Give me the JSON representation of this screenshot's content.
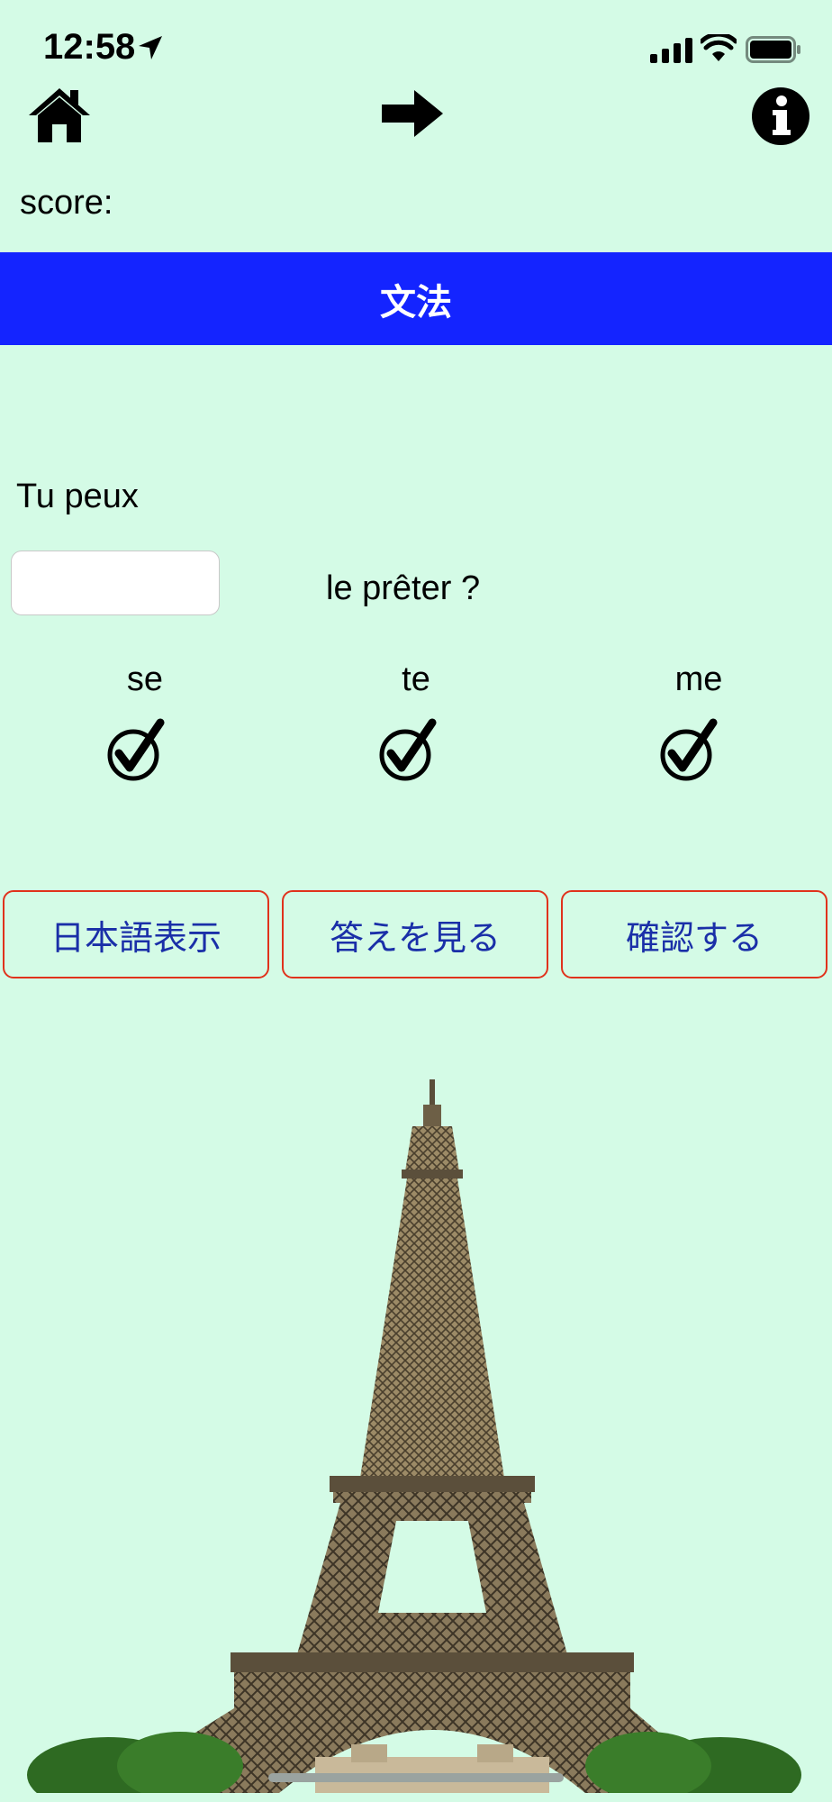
{
  "status_bar": {
    "time": "12:58",
    "icons": [
      "location-arrow-icon",
      "signal-icon",
      "wifi-icon",
      "battery-icon"
    ]
  },
  "nav": {
    "icons": [
      "home-icon",
      "arrow-right-icon",
      "info-icon"
    ]
  },
  "score_label": "score:",
  "banner_title": "文法",
  "question": {
    "line1": "Tu peux",
    "input_value": "",
    "line2": "le prêter ?"
  },
  "choices": [
    {
      "label": "se",
      "icon": "check-circle-icon"
    },
    {
      "label": "te",
      "icon": "check-circle-icon"
    },
    {
      "label": "me",
      "icon": "check-circle-icon"
    }
  ],
  "actions": {
    "show_japanese": "日本語表示",
    "show_answer": "答えを見る",
    "confirm": "確認する"
  },
  "image": {
    "subject": "eiffel-tower-illustration"
  },
  "colors": {
    "background": "#d4fbe6",
    "banner": "#1424ff",
    "button_border": "#e0321c",
    "button_text": "#1a2fa8"
  }
}
